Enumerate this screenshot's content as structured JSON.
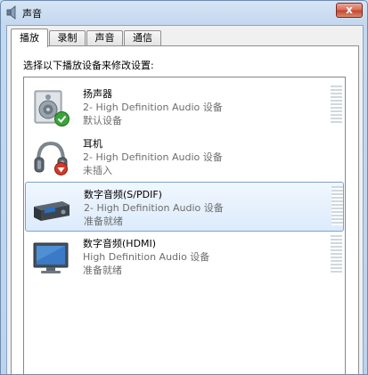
{
  "window": {
    "title": "声音",
    "close_label": "x",
    "icon": "speaker-icon"
  },
  "tabs": [
    {
      "label": "播放",
      "active": true
    },
    {
      "label": "录制",
      "active": false
    },
    {
      "label": "声音",
      "active": false
    },
    {
      "label": "通信",
      "active": false
    }
  ],
  "playback": {
    "instruction": "选择以下播放设备来修改设置:",
    "devices": [
      {
        "name": "扬声器",
        "driver": "2- High Definition Audio 设备",
        "status": "默认设备",
        "icon": "speaker-device-icon",
        "badge": "default-check-icon",
        "selected": false
      },
      {
        "name": "耳机",
        "driver": "2- High Definition Audio 设备",
        "status": "未插入",
        "icon": "headphones-icon",
        "badge": "unplugged-icon",
        "selected": false
      },
      {
        "name": "数字音频(S/PDIF)",
        "driver": "2- High Definition Audio 设备",
        "status": "准备就绪",
        "icon": "digital-receiver-icon",
        "selected": true
      },
      {
        "name": "数字音频(HDMI)",
        "driver": "High Definition Audio 设备",
        "status": "准备就绪",
        "icon": "monitor-icon",
        "selected": false
      }
    ]
  }
}
